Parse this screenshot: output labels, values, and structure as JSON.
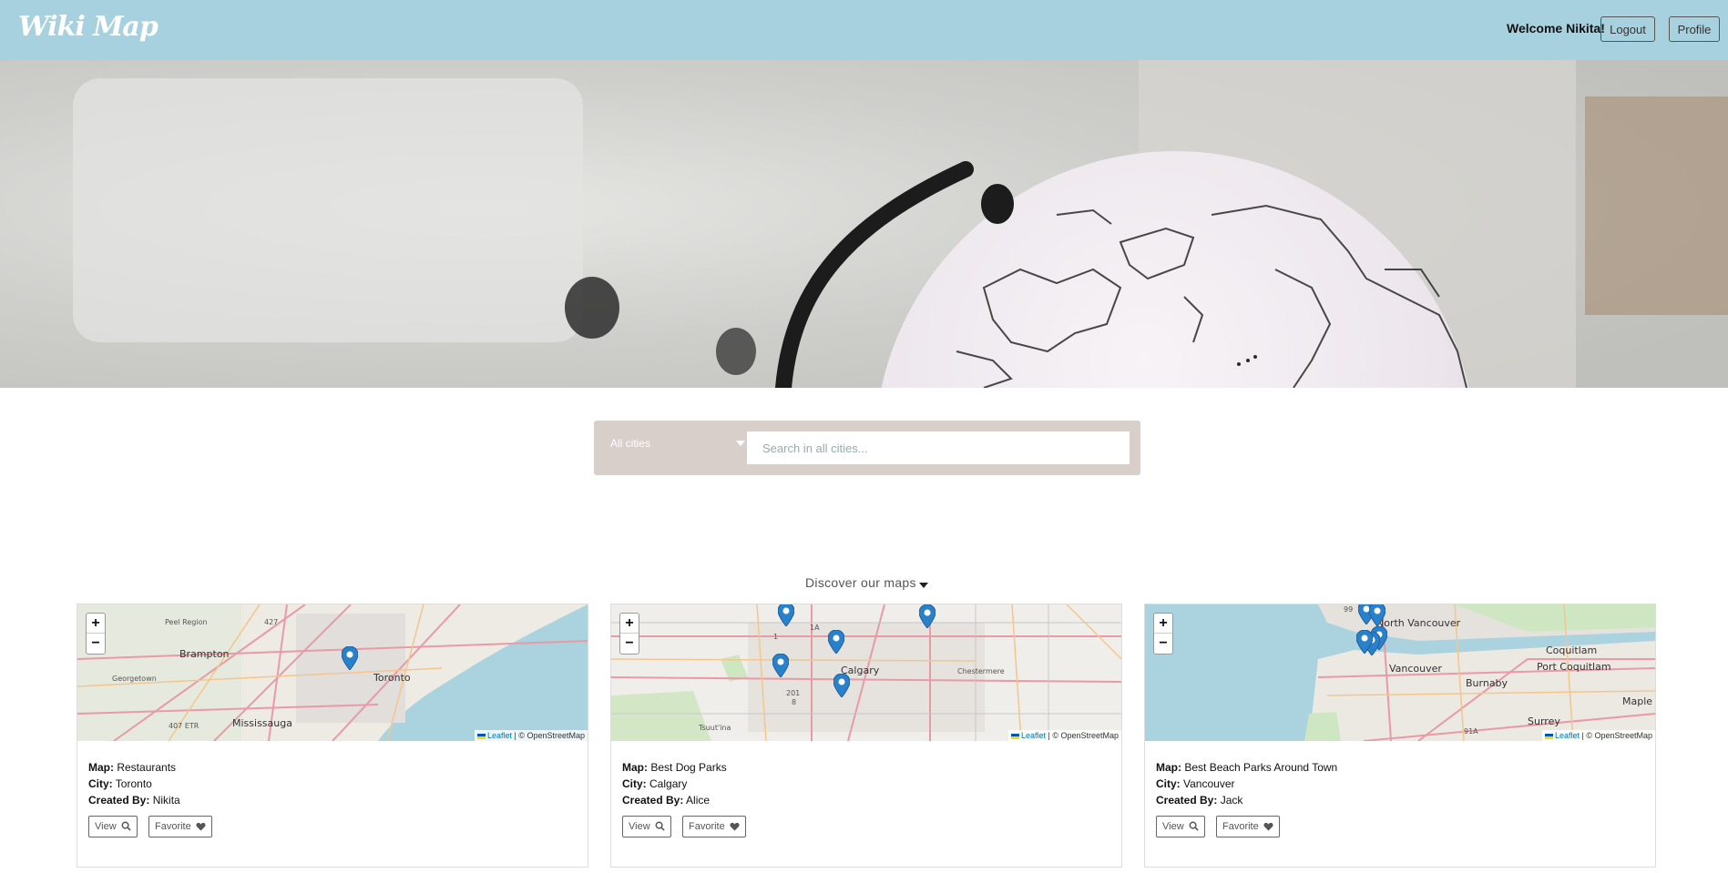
{
  "navbar": {
    "brand": "Wiki Map",
    "welcome": "Welcome Nikita!",
    "logout_label": "Logout",
    "profile_label": "Profile",
    "background_color": "#a8d1e0"
  },
  "hero": {
    "image": "globe-photo"
  },
  "search": {
    "city_selected": "All cities",
    "placeholder": "Search in all cities..."
  },
  "discover": {
    "label": "Discover our maps"
  },
  "map_controls": {
    "zoom_in": "+",
    "zoom_out": "−",
    "attribution_leaflet": "Leaflet",
    "attribution_osm": "| © OpenStreetMap"
  },
  "cards": [
    {
      "map_label": "Map:",
      "map_name": "Restaurants",
      "city_label": "City:",
      "city": "Toronto",
      "created_label": "Created By:",
      "creator": "Nikita",
      "view_label": "View",
      "favorite_label": "Favorite",
      "map_places": [
        "Brampton",
        "Toronto",
        "Mississauga",
        "Georgetown",
        "Peel Region",
        "407 ETR",
        "427"
      ]
    },
    {
      "map_label": "Map:",
      "map_name": "Best Dog Parks",
      "city_label": "City:",
      "city": "Calgary",
      "created_label": "Created By:",
      "creator": "Alice",
      "view_label": "View",
      "favorite_label": "Favorite",
      "map_places": [
        "Calgary",
        "Chestermere",
        "Tsuut'ina",
        "201",
        "1A",
        "1",
        "8"
      ]
    },
    {
      "map_label": "Map:",
      "map_name": "Best Beach Parks Around Town",
      "city_label": "City:",
      "city": "Vancouver",
      "created_label": "Created By:",
      "creator": "Jack",
      "view_label": "View",
      "favorite_label": "Favorite",
      "map_places": [
        "North Vancouver",
        "Vancouver",
        "Coquitlam",
        "Port Coquitlam",
        "Burnaby",
        "Surrey",
        "Maple R",
        "99",
        "91A"
      ]
    }
  ],
  "colors": {
    "search_bg": "#d8ceca",
    "marker_blue": "#2a81cb",
    "water": "#aad3df"
  }
}
